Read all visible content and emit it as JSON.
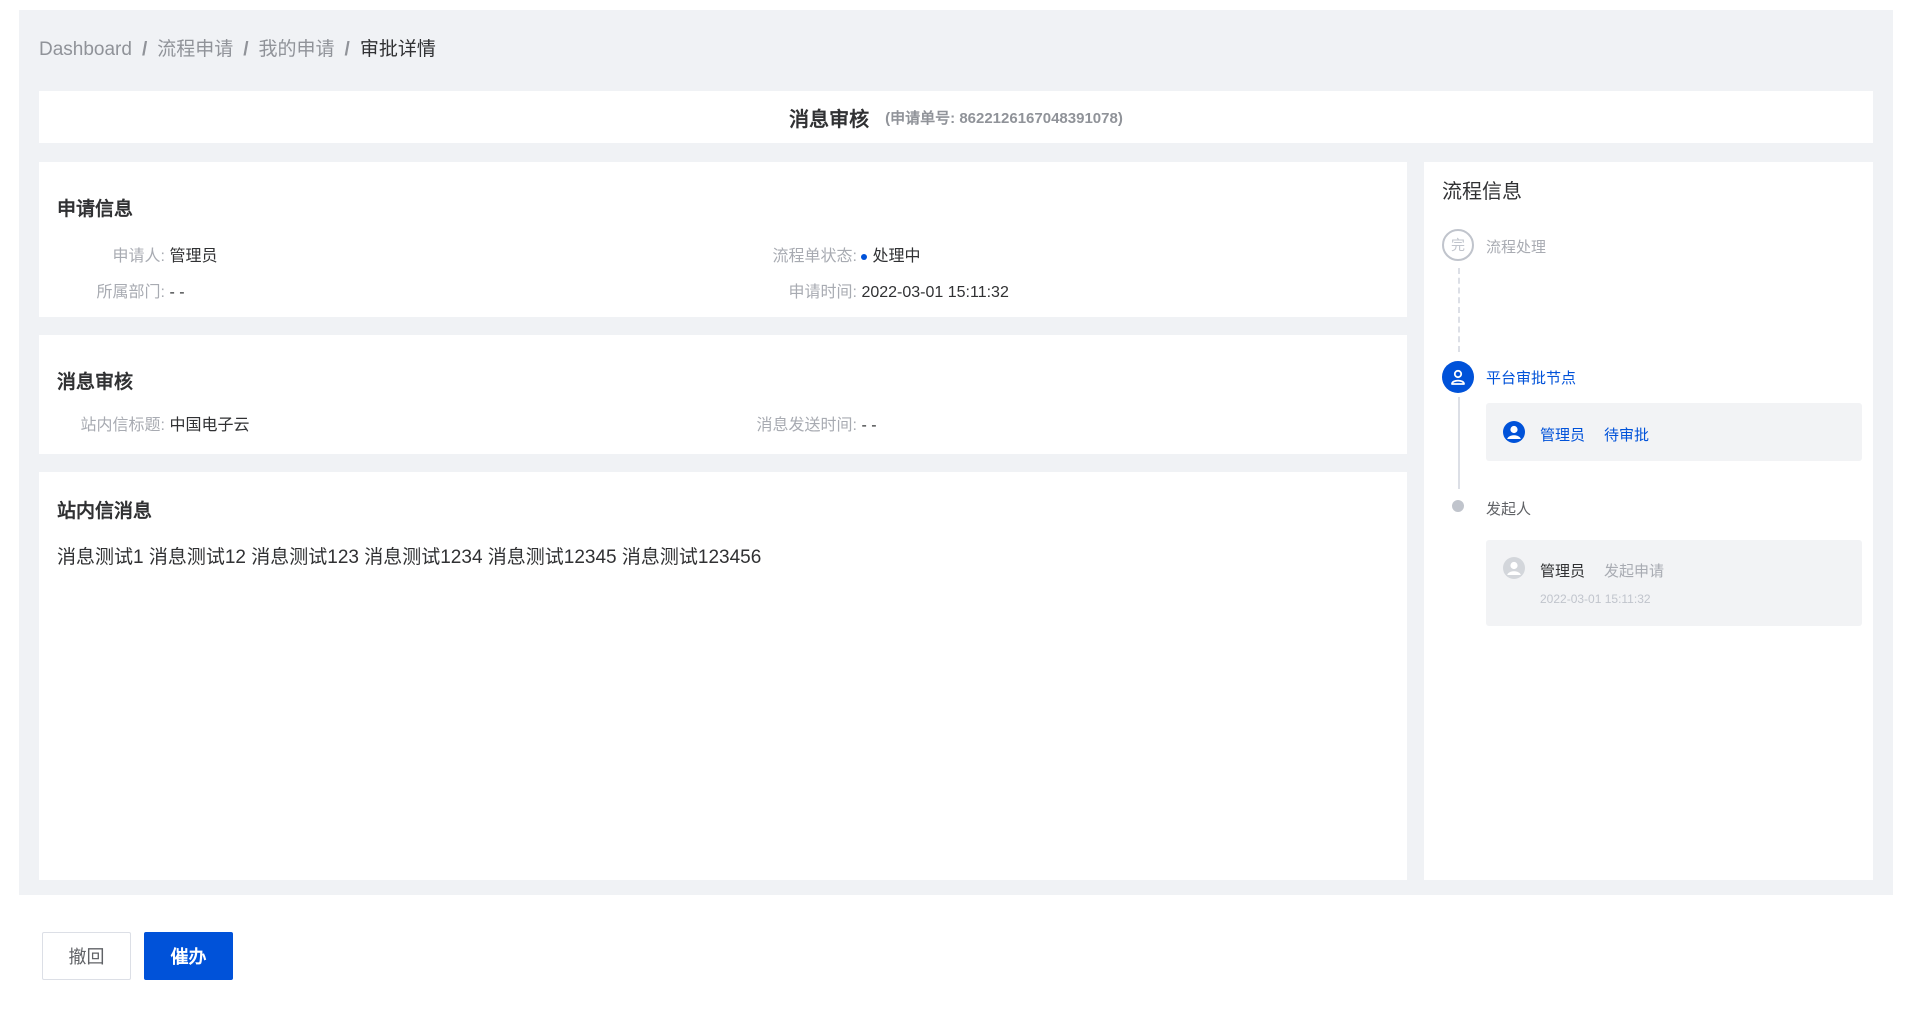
{
  "breadcrumb": [
    "Dashboard",
    "流程申请",
    "我的申请",
    "审批详情"
  ],
  "header": {
    "title": "消息审核",
    "order_no": "(申请单号: 8622126167048391078)"
  },
  "apply_info": {
    "title": "申请信息",
    "applicant_label": "申请人:",
    "applicant": "管理员",
    "status_label": "流程单状态:",
    "status": "处理中",
    "dept_label": "所属部门:",
    "dept": "- -",
    "time_label": "申请时间:",
    "time": "2022-03-01 15:11:32"
  },
  "review": {
    "title": "消息审核",
    "msg_title_label": "站内信标题:",
    "msg_title": "中国电子云",
    "send_time_label": "消息发送时间:",
    "send_time": "- -"
  },
  "message": {
    "title": "站内信消息",
    "content": "消息测试1 消息测试12 消息测试123 消息测试1234 消息测试12345 消息测试123456"
  },
  "flow": {
    "title": "流程信息",
    "done_glyph": "完",
    "done_label": "流程处理",
    "approval_label": "平台审批节点",
    "approver_name": "管理员",
    "approver_status": "待审批",
    "initiator_label": "发起人",
    "initiator_name": "管理员",
    "initiator_action": "发起申请",
    "initiator_time": "2022-03-01 15:11:32"
  },
  "actions": {
    "withdraw": "撤回",
    "urge": "催办"
  },
  "colors": {
    "primary": "#0052d9",
    "background": "#f0f2f5",
    "muted": "#909399"
  }
}
